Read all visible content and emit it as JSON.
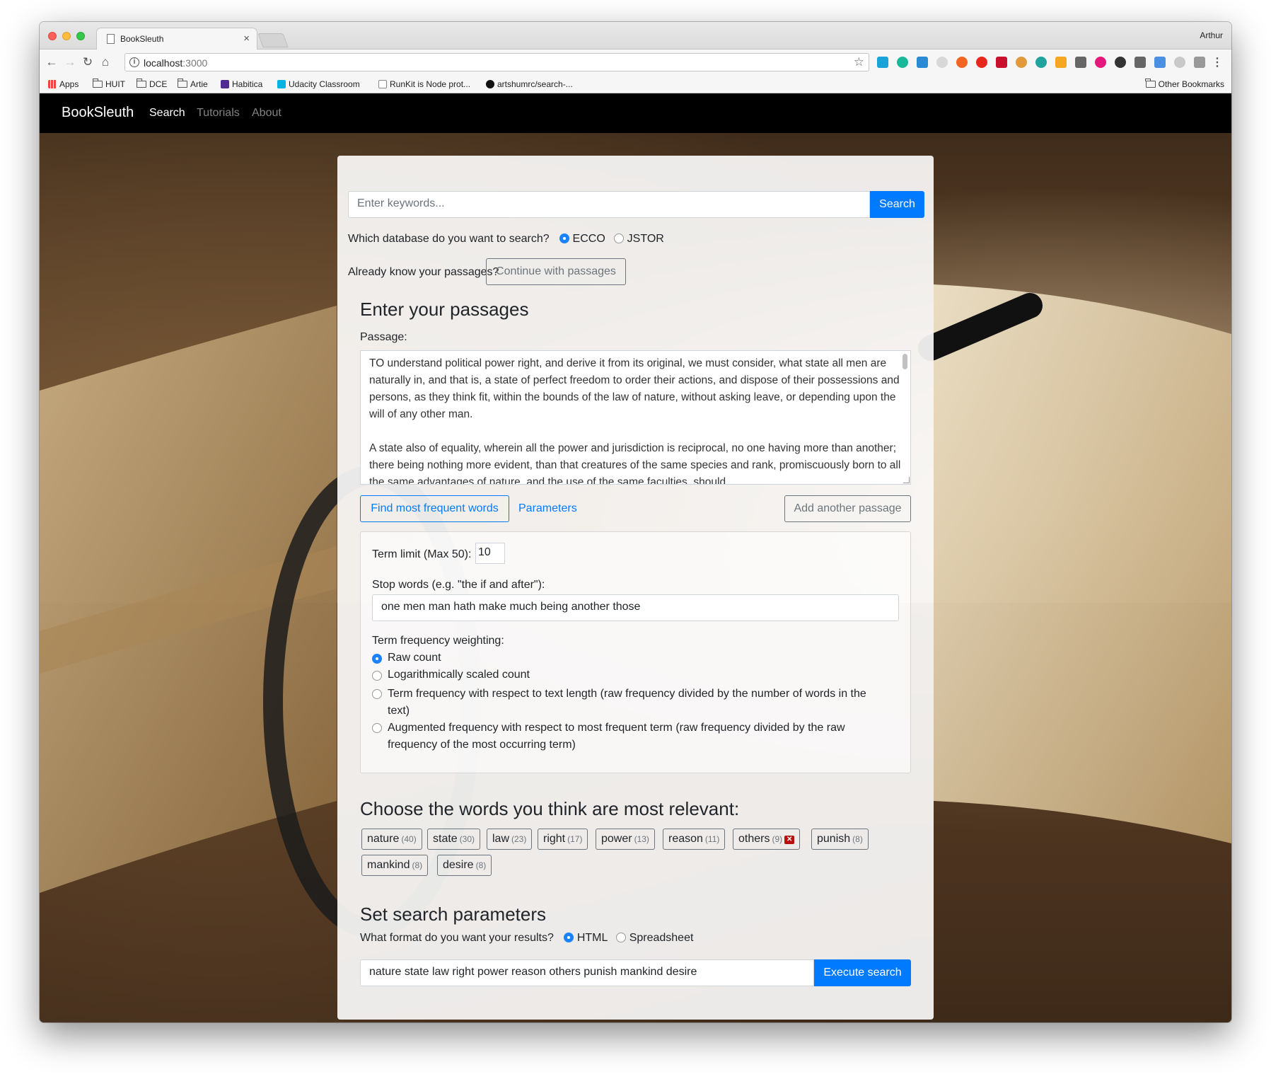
{
  "browser": {
    "tab_title": "BookSleuth",
    "profile": "Arthur",
    "url_host": "localhost",
    "url_port": ":3000",
    "bookmarks": [
      {
        "label": "Apps",
        "icon": "apps-grid-icon"
      },
      {
        "label": "HUIT",
        "icon": "folder-icon"
      },
      {
        "label": "DCE",
        "icon": "folder-icon"
      },
      {
        "label": "Artie",
        "icon": "folder-icon"
      },
      {
        "label": "Habitica",
        "icon": "habitica-icon"
      },
      {
        "label": "Udacity Classroom",
        "icon": "udacity-icon"
      },
      {
        "label": "RunKit is Node prot...",
        "icon": "runkit-icon"
      },
      {
        "label": "artshumrc/search-...",
        "icon": "github-icon"
      }
    ],
    "other_bookmarks": "Other Bookmarks"
  },
  "navbar": {
    "brand": "BookSleuth",
    "links": [
      "Search",
      "Tutorials",
      "About"
    ]
  },
  "search": {
    "placeholder": "Enter keywords...",
    "button": "Search",
    "db_question": "Which database do you want to search?",
    "db_options": [
      "ECCO",
      "JSTOR"
    ],
    "db_selected": "ECCO",
    "passages_question": "Already know your passages?",
    "continue_button": "Continue with passages"
  },
  "passages": {
    "heading": "Enter your passages",
    "label": "Passage:",
    "text": [
      "TO understand political power right, and derive it from its original, we must consider, what state all men are naturally in, and that is, a state of perfect freedom to order their actions, and dispose of their possessions and persons, as they think fit, within the bounds of the law of nature, without asking leave, or depending upon the will of any other man.",
      "A state also of equality, wherein all the power and jurisdiction is reciprocal, no one having more than another; there being nothing more evident, than that creatures of the same species and rank, promiscuously born to all the same advantages of nature, and the use of the same faculties, should"
    ],
    "find_button": "Find most frequent words",
    "parameters_link": "Parameters",
    "add_button": "Add another passage"
  },
  "parameters": {
    "term_limit_label": "Term limit (Max 50):",
    "term_limit_value": "10",
    "stop_words_label": "Stop words (e.g. \"the if and after\"):",
    "stop_words_value": "one men man hath make much being another those",
    "weighting_label": "Term frequency weighting:",
    "weighting_options": [
      "Raw count",
      "Logarithmically scaled count",
      "Term frequency with respect to text length (raw frequency divided by the number of words in the",
      "text)",
      "Augmented frequency with respect to most frequent term (raw frequency divided by the raw",
      "frequency of the most occurring term)"
    ],
    "weighting_selected": "Raw count"
  },
  "relevant": {
    "heading": "Choose the words you think are most relevant:",
    "words": [
      {
        "word": "nature",
        "count": "(40)"
      },
      {
        "word": "state",
        "count": "(30)"
      },
      {
        "word": "law",
        "count": "(23)"
      },
      {
        "word": "right",
        "count": "(17)"
      },
      {
        "word": "power",
        "count": "(13)"
      },
      {
        "word": "reason",
        "count": "(11)"
      },
      {
        "word": "others",
        "count": "(9)"
      },
      {
        "word": "punish",
        "count": "(8)"
      },
      {
        "word": "mankind",
        "count": "(8)"
      },
      {
        "word": "desire",
        "count": "(8)"
      }
    ]
  },
  "search_params": {
    "heading": "Set search parameters",
    "format_question": "What format do you want your results?",
    "format_options": [
      "HTML",
      "Spreadsheet"
    ],
    "format_selected": "HTML",
    "query_value": "nature state law right power reason others punish mankind desire",
    "execute_button": "Execute search"
  },
  "colors": {
    "primary": "#007bff",
    "navbar": "#000000",
    "remove_badge": "#b80f0f"
  }
}
